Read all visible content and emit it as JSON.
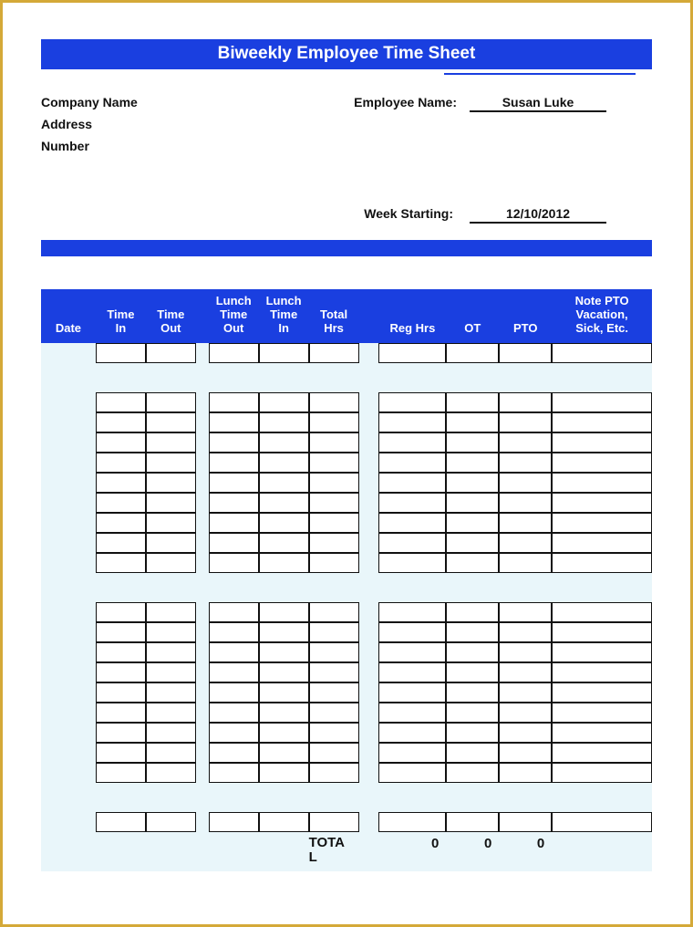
{
  "title": "Biweekly Employee Time Sheet",
  "company_name_label": "Company Name",
  "address_label": "Address",
  "number_label": "Number",
  "employee_name_label": "Employee Name:",
  "employee_name": "Susan Luke",
  "week_starting_label": "Week Starting:",
  "week_starting": "12/10/2012",
  "columns": {
    "date": "Date",
    "time_in": "Time In",
    "time_out": "Time Out",
    "lunch_out": "Lunch Time Out",
    "lunch_in": "Lunch Time In",
    "total_hrs": "Total Hrs",
    "reg_hrs": "Reg Hrs",
    "ot": "OT",
    "pto": "PTO",
    "note": "Note PTO Vacation, Sick, Etc."
  },
  "totals": {
    "label_line1": "TOTA",
    "label_line2": "L",
    "reg": "0",
    "ot": "0",
    "pto": "0"
  }
}
